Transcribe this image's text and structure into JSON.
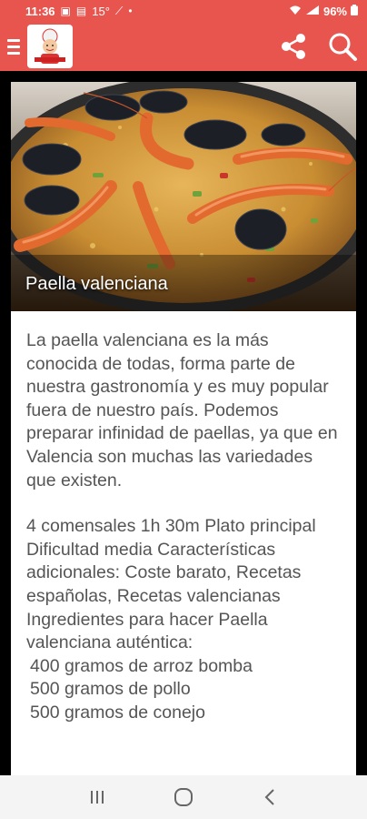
{
  "status_bar": {
    "time": "11:36",
    "temperature": "15°",
    "battery": "96%"
  },
  "app_bar": {
    "menu_icon": "hamburger-icon",
    "logo_icon": "chef-logo-icon",
    "share_icon": "share-icon",
    "search_icon": "search-icon"
  },
  "hero": {
    "caption": "Paella valenciana"
  },
  "content": {
    "description": "La paella valenciana es la más conocida de todas, forma parte de nuestra gastronomía y es muy popular fuera de nuestro país. Podemos preparar infinidad de paellas, ya que en Valencia son muchas las variedades que existen.",
    "meta": "4 comensales 1h 30m Plato principal Dificultad media Características adicionales: Coste barato, Recetas españolas, Recetas valencianas",
    "ingredients_title": "Ingredientes para hacer Paella valenciana auténtica:",
    "ingredients": [
      "400 gramos de arroz bomba",
      "500 gramos de pollo",
      "500 gramos de conejo"
    ]
  },
  "nav_bar": {
    "recents_icon": "recents-icon",
    "home_icon": "home-icon",
    "back_icon": "back-icon"
  },
  "colors": {
    "accent": "#e8554f",
    "text": "#555555",
    "nav_background": "#f4f4f4"
  }
}
